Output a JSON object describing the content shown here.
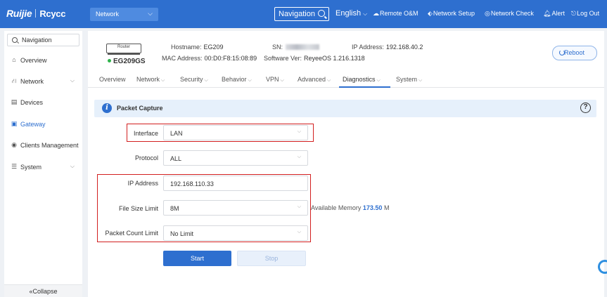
{
  "topbar": {
    "logo": "Ruijie",
    "logo_sub": "Rcycc",
    "network_select": "Network",
    "navigation_box": "Navigation",
    "language": "English",
    "links": {
      "remote": "Remote O&M",
      "setup": "Network Setup",
      "check": "Network Check",
      "alert": "Alert",
      "logout": "Log Out"
    }
  },
  "sidebar": {
    "search": "Navigation",
    "items": [
      {
        "label": "Overview",
        "icon": "home-icon"
      },
      {
        "label": "Network",
        "icon": "network-icon",
        "expandable": true
      },
      {
        "label": "Devices",
        "icon": "devices-icon"
      },
      {
        "label": "Gateway",
        "icon": "gateway-icon",
        "active": true
      },
      {
        "label": "Clients Management",
        "icon": "clients-icon"
      },
      {
        "label": "System",
        "icon": "system-icon",
        "expandable": true
      }
    ],
    "collapse": "Collapse"
  },
  "device": {
    "icon_label": "Router",
    "model": "EG209GS",
    "status_color": "#2db34a",
    "hostname_label": "Hostname:",
    "hostname": "EG209",
    "sn_label": "SN:",
    "mac_label": "MAC Address:",
    "mac": "00:D0:F8:15:08:89",
    "software_label": "Software Ver:",
    "software": "ReyeeOS 1.216.1318",
    "ip_label": "IP Address:",
    "ip": "192.168.40.2",
    "reboot": "Reboot"
  },
  "tabs": [
    {
      "label": "Overview",
      "chevron": false
    },
    {
      "label": "Network",
      "chevron": true
    },
    {
      "label": "Security",
      "chevron": true
    },
    {
      "label": "Behavior",
      "chevron": true
    },
    {
      "label": "VPN",
      "chevron": true
    },
    {
      "label": "Advanced",
      "chevron": true
    },
    {
      "label": "Diagnostics",
      "chevron": true,
      "active": true
    },
    {
      "label": "System",
      "chevron": true
    }
  ],
  "section": {
    "title": "Packet Capture",
    "help": "?"
  },
  "form": {
    "interface_label": "Interface",
    "interface_value": "LAN",
    "protocol_label": "Protocol",
    "protocol_value": "ALL",
    "ip_label": "IP Address",
    "ip_value": "192.168.110.33",
    "filesize_label": "File Size Limit",
    "filesize_value": "8M",
    "available_label": "Available Memory",
    "available_value": "173.50",
    "available_unit": "M",
    "packetcount_label": "Packet Count Limit",
    "packetcount_value": "No Limit",
    "start": "Start",
    "stop": "Stop"
  },
  "colors": {
    "accent": "#2e6fcf",
    "highlight_box": "#d21f1f"
  }
}
